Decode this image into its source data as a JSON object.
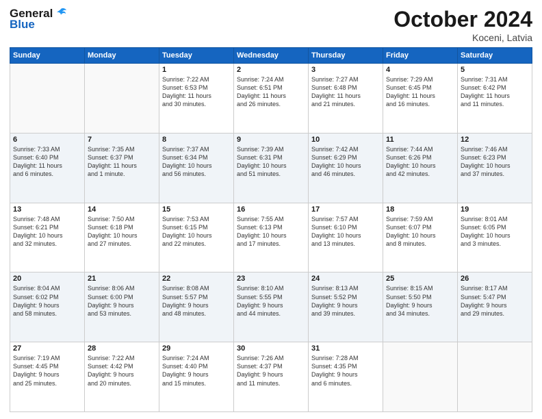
{
  "header": {
    "logo_general": "General",
    "logo_blue": "Blue",
    "title": "October 2024",
    "location": "Koceni, Latvia"
  },
  "weekdays": [
    "Sunday",
    "Monday",
    "Tuesday",
    "Wednesday",
    "Thursday",
    "Friday",
    "Saturday"
  ],
  "weeks": [
    {
      "shade": false,
      "days": [
        {
          "number": "",
          "info": ""
        },
        {
          "number": "",
          "info": ""
        },
        {
          "number": "1",
          "info": "Sunrise: 7:22 AM\nSunset: 6:53 PM\nDaylight: 11 hours\nand 30 minutes."
        },
        {
          "number": "2",
          "info": "Sunrise: 7:24 AM\nSunset: 6:51 PM\nDaylight: 11 hours\nand 26 minutes."
        },
        {
          "number": "3",
          "info": "Sunrise: 7:27 AM\nSunset: 6:48 PM\nDaylight: 11 hours\nand 21 minutes."
        },
        {
          "number": "4",
          "info": "Sunrise: 7:29 AM\nSunset: 6:45 PM\nDaylight: 11 hours\nand 16 minutes."
        },
        {
          "number": "5",
          "info": "Sunrise: 7:31 AM\nSunset: 6:42 PM\nDaylight: 11 hours\nand 11 minutes."
        }
      ]
    },
    {
      "shade": true,
      "days": [
        {
          "number": "6",
          "info": "Sunrise: 7:33 AM\nSunset: 6:40 PM\nDaylight: 11 hours\nand 6 minutes."
        },
        {
          "number": "7",
          "info": "Sunrise: 7:35 AM\nSunset: 6:37 PM\nDaylight: 11 hours\nand 1 minute."
        },
        {
          "number": "8",
          "info": "Sunrise: 7:37 AM\nSunset: 6:34 PM\nDaylight: 10 hours\nand 56 minutes."
        },
        {
          "number": "9",
          "info": "Sunrise: 7:39 AM\nSunset: 6:31 PM\nDaylight: 10 hours\nand 51 minutes."
        },
        {
          "number": "10",
          "info": "Sunrise: 7:42 AM\nSunset: 6:29 PM\nDaylight: 10 hours\nand 46 minutes."
        },
        {
          "number": "11",
          "info": "Sunrise: 7:44 AM\nSunset: 6:26 PM\nDaylight: 10 hours\nand 42 minutes."
        },
        {
          "number": "12",
          "info": "Sunrise: 7:46 AM\nSunset: 6:23 PM\nDaylight: 10 hours\nand 37 minutes."
        }
      ]
    },
    {
      "shade": false,
      "days": [
        {
          "number": "13",
          "info": "Sunrise: 7:48 AM\nSunset: 6:21 PM\nDaylight: 10 hours\nand 32 minutes."
        },
        {
          "number": "14",
          "info": "Sunrise: 7:50 AM\nSunset: 6:18 PM\nDaylight: 10 hours\nand 27 minutes."
        },
        {
          "number": "15",
          "info": "Sunrise: 7:53 AM\nSunset: 6:15 PM\nDaylight: 10 hours\nand 22 minutes."
        },
        {
          "number": "16",
          "info": "Sunrise: 7:55 AM\nSunset: 6:13 PM\nDaylight: 10 hours\nand 17 minutes."
        },
        {
          "number": "17",
          "info": "Sunrise: 7:57 AM\nSunset: 6:10 PM\nDaylight: 10 hours\nand 13 minutes."
        },
        {
          "number": "18",
          "info": "Sunrise: 7:59 AM\nSunset: 6:07 PM\nDaylight: 10 hours\nand 8 minutes."
        },
        {
          "number": "19",
          "info": "Sunrise: 8:01 AM\nSunset: 6:05 PM\nDaylight: 10 hours\nand 3 minutes."
        }
      ]
    },
    {
      "shade": true,
      "days": [
        {
          "number": "20",
          "info": "Sunrise: 8:04 AM\nSunset: 6:02 PM\nDaylight: 9 hours\nand 58 minutes."
        },
        {
          "number": "21",
          "info": "Sunrise: 8:06 AM\nSunset: 6:00 PM\nDaylight: 9 hours\nand 53 minutes."
        },
        {
          "number": "22",
          "info": "Sunrise: 8:08 AM\nSunset: 5:57 PM\nDaylight: 9 hours\nand 48 minutes."
        },
        {
          "number": "23",
          "info": "Sunrise: 8:10 AM\nSunset: 5:55 PM\nDaylight: 9 hours\nand 44 minutes."
        },
        {
          "number": "24",
          "info": "Sunrise: 8:13 AM\nSunset: 5:52 PM\nDaylight: 9 hours\nand 39 minutes."
        },
        {
          "number": "25",
          "info": "Sunrise: 8:15 AM\nSunset: 5:50 PM\nDaylight: 9 hours\nand 34 minutes."
        },
        {
          "number": "26",
          "info": "Sunrise: 8:17 AM\nSunset: 5:47 PM\nDaylight: 9 hours\nand 29 minutes."
        }
      ]
    },
    {
      "shade": false,
      "days": [
        {
          "number": "27",
          "info": "Sunrise: 7:19 AM\nSunset: 4:45 PM\nDaylight: 9 hours\nand 25 minutes."
        },
        {
          "number": "28",
          "info": "Sunrise: 7:22 AM\nSunset: 4:42 PM\nDaylight: 9 hours\nand 20 minutes."
        },
        {
          "number": "29",
          "info": "Sunrise: 7:24 AM\nSunset: 4:40 PM\nDaylight: 9 hours\nand 15 minutes."
        },
        {
          "number": "30",
          "info": "Sunrise: 7:26 AM\nSunset: 4:37 PM\nDaylight: 9 hours\nand 11 minutes."
        },
        {
          "number": "31",
          "info": "Sunrise: 7:28 AM\nSunset: 4:35 PM\nDaylight: 9 hours\nand 6 minutes."
        },
        {
          "number": "",
          "info": ""
        },
        {
          "number": "",
          "info": ""
        }
      ]
    }
  ]
}
